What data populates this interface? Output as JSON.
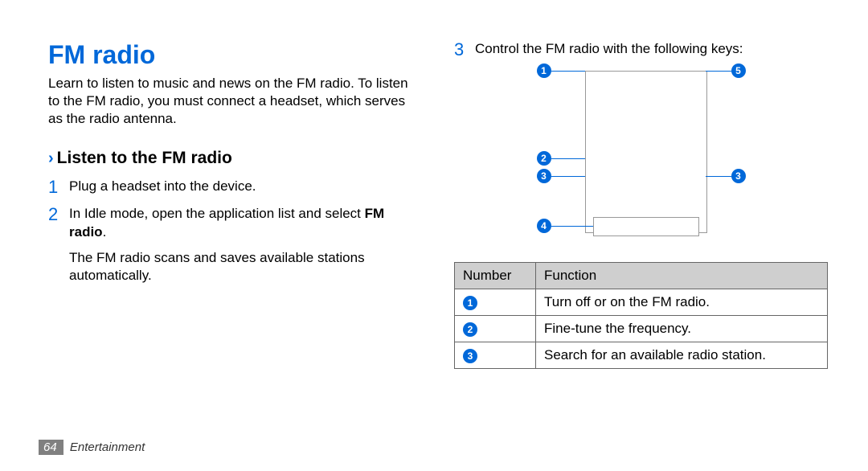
{
  "title": "FM radio",
  "intro": "Learn to listen to music and news on the FM radio. To listen to the FM radio, you must connect a headset, which serves as the radio antenna.",
  "subhead_chev": "›",
  "subhead": "Listen to the FM radio",
  "steps": {
    "s1_num": "1",
    "s1_text": "Plug a headset into the device.",
    "s2_num": "2",
    "s2_text_a": "In Idle mode, open the application list and select ",
    "s2_text_b": "FM radio",
    "s2_text_c": ".",
    "s2_sub": "The FM radio scans and saves available stations automatically.",
    "s3_num": "3",
    "s3_text": "Control the FM radio with the following keys:"
  },
  "callouts": {
    "c1": "1",
    "c2": "2",
    "c3": "3",
    "c3b": "3",
    "c4": "4",
    "c5": "5"
  },
  "table": {
    "hdr_num": "Number",
    "hdr_func": "Function",
    "rows": [
      {
        "num": "1",
        "func": "Turn off or on the FM radio."
      },
      {
        "num": "2",
        "func": "Fine-tune the frequency."
      },
      {
        "num": "3",
        "func": "Search for an available radio station."
      }
    ]
  },
  "footer": {
    "page": "64",
    "section": "Entertainment"
  }
}
